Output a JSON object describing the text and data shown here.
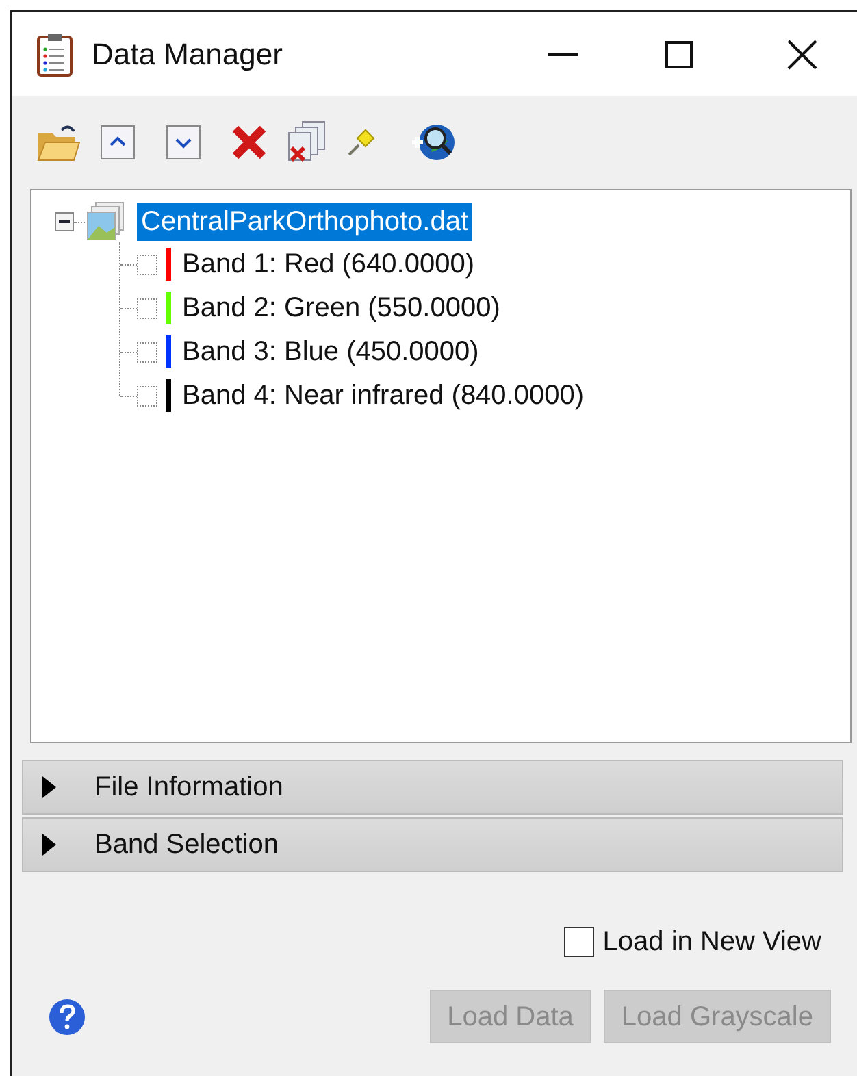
{
  "window": {
    "title": "Data Manager"
  },
  "tree": {
    "label": "CentralParkOrthophoto.dat",
    "selected": true,
    "expanded": true,
    "children": [
      {
        "label": "Band 1: Red (640.0000)",
        "color": "#ff0000",
        "checked": false
      },
      {
        "label": "Band 2: Green (550.0000)",
        "color": "#66ff00",
        "checked": false
      },
      {
        "label": "Band 3: Blue (450.0000)",
        "color": "#0033ff",
        "checked": false
      },
      {
        "label": "Band 4: Near infrared (840.0000)",
        "color": "#000000",
        "checked": false
      }
    ]
  },
  "sections": [
    {
      "label": "File Information",
      "expanded": false
    },
    {
      "label": "Band Selection",
      "expanded": false
    }
  ],
  "load_in_new_view": {
    "label": "Load in New View",
    "checked": false
  },
  "buttons": [
    {
      "label": "Load Data",
      "disabled": true
    },
    {
      "label": "Load Grayscale",
      "disabled": true
    }
  ]
}
